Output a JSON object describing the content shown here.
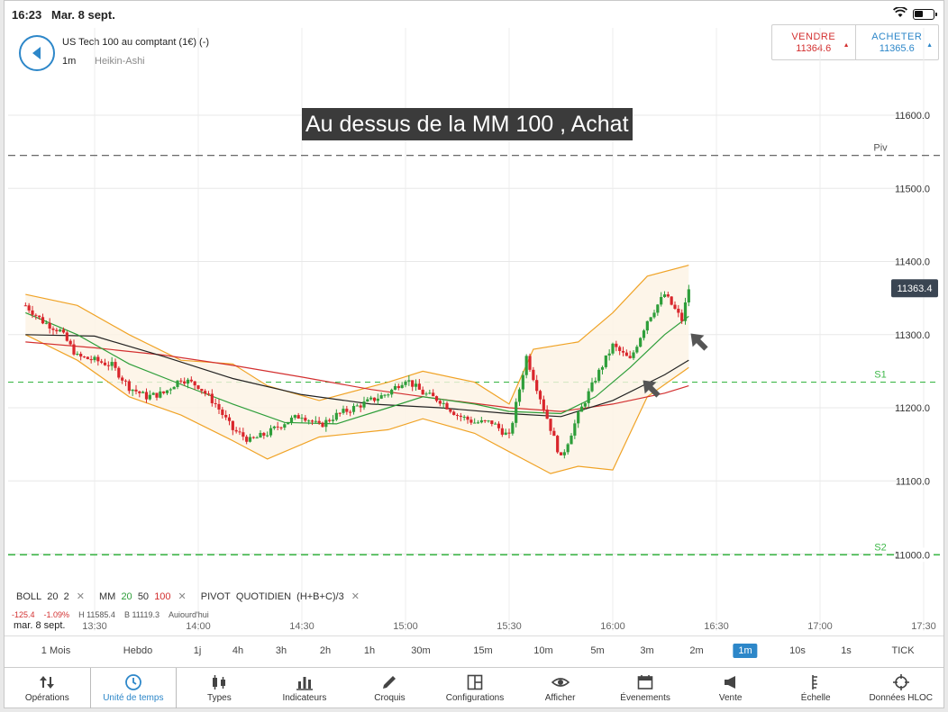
{
  "status": {
    "time": "16:23",
    "date": "Mar. 8 sept."
  },
  "header": {
    "instrument": "US Tech 100 au comptant (1€) (-)",
    "timeframe": "1m",
    "chart_type": "Heikin-Ashi",
    "sell": {
      "label": "VENDRE",
      "price": "11364.6"
    },
    "buy": {
      "label": "ACHETER",
      "price": "11365.6"
    }
  },
  "annotation": "Au dessus de la MM 100 , Achat",
  "legend": {
    "boll": {
      "name": "BOLL",
      "p1": "20",
      "p2": "2"
    },
    "mm": {
      "name": "MM",
      "v1": "20",
      "v2": "50",
      "v3": "100"
    },
    "pivot": {
      "name": "PIVOT",
      "period": "QUOTIDIEN",
      "formula": "(H+B+C)/3"
    },
    "sub": [
      "-125.4",
      "-1.09%",
      "H 11585.4",
      "B 11119.3",
      "Aujourd'hui"
    ]
  },
  "xaxis_date": "mar. 8 sept.",
  "timeframes": [
    "1 Mois",
    "Hebdo",
    "1j",
    "4h",
    "3h",
    "2h",
    "1h",
    "30m",
    "15m",
    "10m",
    "5m",
    "3m",
    "2m",
    "1m",
    "10s",
    "1s",
    "TICK"
  ],
  "active_timeframe": "1m",
  "toolbar": [
    {
      "label": "Opérations",
      "icon": "sort-arrows-icon"
    },
    {
      "label": "Unité de temps",
      "icon": "clock-icon"
    },
    {
      "label": "Types",
      "icon": "candles-icon"
    },
    {
      "label": "Indicateurs",
      "icon": "bar-chart-icon"
    },
    {
      "label": "Croquis",
      "icon": "pencil-icon"
    },
    {
      "label": "Configurations",
      "icon": "layout-icon"
    },
    {
      "label": "Afficher",
      "icon": "eye-icon"
    },
    {
      "label": "Évenements",
      "icon": "calendar-icon"
    },
    {
      "label": "Vente",
      "icon": "megaphone-icon"
    },
    {
      "label": "Échelle",
      "icon": "scale-icon"
    },
    {
      "label": "Données HLOC",
      "icon": "crosshair-icon"
    }
  ],
  "colors": {
    "accent": "#2d87c9",
    "bull": "#2e9e3a",
    "bear": "#d9262c",
    "bollinger": "#f0a326",
    "mm20": "#2e9e3a",
    "mm50": "#222222",
    "mm100": "#d33030",
    "pivot": "#555555",
    "support": "#3fb84a"
  },
  "chart_data": {
    "type": "candlestick",
    "title": "",
    "ylim": [
      10950,
      11660
    ],
    "y_ticks": [
      "11600.0",
      "11500.0",
      "11400.0",
      "11300.0",
      "11200.0",
      "11100.0",
      "11000.0"
    ],
    "x_ticks": [
      "13:30",
      "14:00",
      "14:30",
      "15:00",
      "15:30",
      "16:00",
      "16:30",
      "17:00",
      "17:30"
    ],
    "current_price": "11363.4",
    "levels": [
      {
        "name": "Piv",
        "value": 11545
      },
      {
        "name": "S1",
        "value": 11235
      },
      {
        "name": "S2",
        "value": 10999
      }
    ],
    "price_path": [
      [
        "13:10",
        11340
      ],
      [
        "13:15",
        11318
      ],
      [
        "13:20",
        11305
      ],
      [
        "13:25",
        11270
      ],
      [
        "13:30",
        11265
      ],
      [
        "13:35",
        11258
      ],
      [
        "13:40",
        11228
      ],
      [
        "13:45",
        11215
      ],
      [
        "13:50",
        11220
      ],
      [
        "13:55",
        11240
      ],
      [
        "14:00",
        11230
      ],
      [
        "14:05",
        11205
      ],
      [
        "14:10",
        11170
      ],
      [
        "14:15",
        11155
      ],
      [
        "14:20",
        11165
      ],
      [
        "14:25",
        11180
      ],
      [
        "14:30",
        11190
      ],
      [
        "14:35",
        11175
      ],
      [
        "14:40",
        11190
      ],
      [
        "14:45",
        11200
      ],
      [
        "14:50",
        11210
      ],
      [
        "14:55",
        11220
      ],
      [
        "15:00",
        11240
      ],
      [
        "15:05",
        11220
      ],
      [
        "15:10",
        11210
      ],
      [
        "15:15",
        11190
      ],
      [
        "15:20",
        11180
      ],
      [
        "15:25",
        11180
      ],
      [
        "15:30",
        11160
      ],
      [
        "15:35",
        11270
      ],
      [
        "15:40",
        11200
      ],
      [
        "15:45",
        11130
      ],
      [
        "15:50",
        11190
      ],
      [
        "15:55",
        11240
      ],
      [
        "16:00",
        11285
      ],
      [
        "16:05",
        11265
      ],
      [
        "16:10",
        11320
      ],
      [
        "16:15",
        11355
      ],
      [
        "16:20",
        11320
      ],
      [
        "16:22",
        11363
      ]
    ],
    "mm20": [
      [
        "13:10",
        11330
      ],
      [
        "13:25",
        11300
      ],
      [
        "13:40",
        11260
      ],
      [
        "13:55",
        11232
      ],
      [
        "14:10",
        11205
      ],
      [
        "14:25",
        11180
      ],
      [
        "14:40",
        11178
      ],
      [
        "14:55",
        11200
      ],
      [
        "15:05",
        11215
      ],
      [
        "15:20",
        11205
      ],
      [
        "15:30",
        11195
      ],
      [
        "15:45",
        11192
      ],
      [
        "15:55",
        11215
      ],
      [
        "16:05",
        11255
      ],
      [
        "16:15",
        11300
      ],
      [
        "16:22",
        11325
      ]
    ],
    "mm50": [
      [
        "13:10",
        11300
      ],
      [
        "13:30",
        11298
      ],
      [
        "13:50",
        11270
      ],
      [
        "14:10",
        11240
      ],
      [
        "14:30",
        11218
      ],
      [
        "14:50",
        11205
      ],
      [
        "15:10",
        11200
      ],
      [
        "15:30",
        11192
      ],
      [
        "15:45",
        11188
      ],
      [
        "16:00",
        11210
      ],
      [
        "16:15",
        11245
      ],
      [
        "16:22",
        11265
      ]
    ],
    "mm100": [
      [
        "13:10",
        11290
      ],
      [
        "13:30",
        11282
      ],
      [
        "13:50",
        11272
      ],
      [
        "14:10",
        11258
      ],
      [
        "14:30",
        11242
      ],
      [
        "14:50",
        11225
      ],
      [
        "15:10",
        11212
      ],
      [
        "15:30",
        11200
      ],
      [
        "15:45",
        11195
      ],
      [
        "16:00",
        11205
      ],
      [
        "16:15",
        11220
      ],
      [
        "16:22",
        11230
      ]
    ],
    "boll_upper": [
      [
        "13:10",
        11355
      ],
      [
        "13:25",
        11340
      ],
      [
        "13:40",
        11300
      ],
      [
        "13:55",
        11265
      ],
      [
        "14:10",
        11260
      ],
      [
        "14:20",
        11230
      ],
      [
        "14:35",
        11210
      ],
      [
        "14:55",
        11235
      ],
      [
        "15:05",
        11250
      ],
      [
        "15:20",
        11235
      ],
      [
        "15:30",
        11205
      ],
      [
        "15:37",
        11280
      ],
      [
        "15:50",
        11290
      ],
      [
        "16:00",
        11330
      ],
      [
        "16:10",
        11380
      ],
      [
        "16:22",
        11395
      ]
    ],
    "boll_lower": [
      [
        "13:10",
        11300
      ],
      [
        "13:25",
        11265
      ],
      [
        "13:40",
        11215
      ],
      [
        "13:55",
        11190
      ],
      [
        "14:10",
        11155
      ],
      [
        "14:20",
        11130
      ],
      [
        "14:35",
        11160
      ],
      [
        "14:55",
        11170
      ],
      [
        "15:05",
        11185
      ],
      [
        "15:20",
        11165
      ],
      [
        "15:30",
        11140
      ],
      [
        "15:42",
        11110
      ],
      [
        "15:50",
        11120
      ],
      [
        "16:00",
        11115
      ],
      [
        "16:10",
        11215
      ],
      [
        "16:22",
        11255
      ]
    ]
  }
}
